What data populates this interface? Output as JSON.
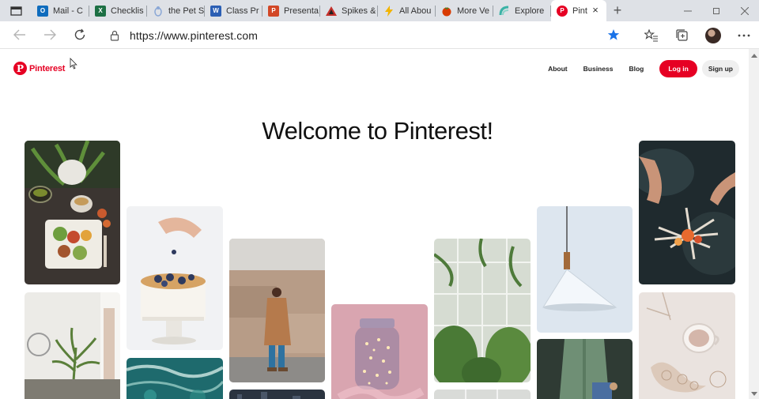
{
  "browser": {
    "tabs": [
      {
        "title": "Mail - C",
        "favicon": "outlook-icon",
        "color": "#0f6cbd"
      },
      {
        "title": "Checklis",
        "favicon": "excel-icon",
        "color": "#1d7044"
      },
      {
        "title": "the Pet S",
        "favicon": "petshop-icon",
        "color": "#8aa7d6"
      },
      {
        "title": "Class Pr",
        "favicon": "word-icon",
        "color": "#2b5fb4"
      },
      {
        "title": "Presenta",
        "favicon": "powerpoint-icon",
        "color": "#d24726"
      },
      {
        "title": "Spikes &",
        "favicon": "spikes-icon",
        "color": "#c4302b"
      },
      {
        "title": "All Abou",
        "favicon": "lightning-icon",
        "color": "#f2b400"
      },
      {
        "title": "More Ve",
        "favicon": "tomato-icon",
        "color": "#d83b01"
      },
      {
        "title": "Explore",
        "favicon": "explore-icon",
        "color": "#3bb3a6"
      }
    ],
    "active_tab": {
      "title": "Pint",
      "favicon": "pinterest-icon",
      "close": "×"
    },
    "new_tab": "+",
    "url": "https://www.pinterest.com"
  },
  "site": {
    "logo_text": "Pinterest",
    "logo_letter": "P",
    "brand_color": "#e60023",
    "nav": {
      "about": "About",
      "business": "Business",
      "blog": "Blog"
    },
    "login": "Log in",
    "signup": "Sign up",
    "heading": "Welcome to Pinterest!"
  },
  "pins": [
    {
      "name": "pin-salad-bowl",
      "subject": "salad and tea on dark table"
    },
    {
      "name": "pin-plant-interior",
      "subject": "plants in white room"
    },
    {
      "name": "pin-blueberry-cake",
      "subject": "hand topping cake with blueberries"
    },
    {
      "name": "pin-ocean-aerial",
      "subject": "aerial turquoise waves"
    },
    {
      "name": "pin-man-street",
      "subject": "man in camel coat by stone wall"
    },
    {
      "name": "pin-dark-city",
      "subject": "dark cityscape"
    },
    {
      "name": "pin-jar-lights",
      "subject": "jar of fairy lights"
    },
    {
      "name": "pin-greenhouse",
      "subject": "greenhouse interior"
    },
    {
      "name": "pin-greenhouse-2",
      "subject": "greenhouse detail"
    },
    {
      "name": "pin-pendant-lamp",
      "subject": "white pendant lamp"
    },
    {
      "name": "pin-man-denim",
      "subject": "man in denim shirt"
    },
    {
      "name": "pin-campfire",
      "subject": "hands lighting campfire"
    },
    {
      "name": "pin-coffee-flatlay",
      "subject": "coffee cup and lace flatlay"
    }
  ]
}
